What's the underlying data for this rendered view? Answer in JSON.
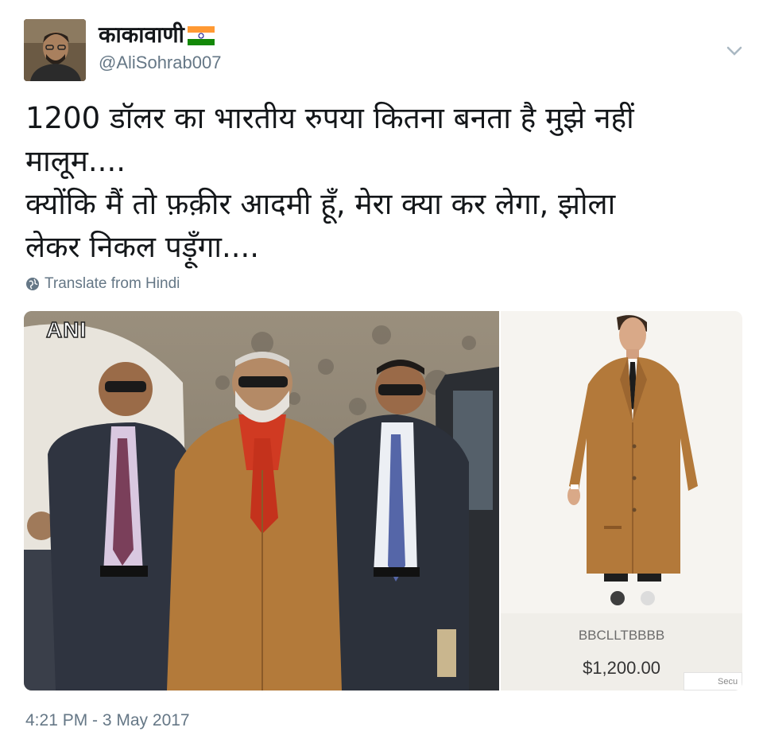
{
  "user": {
    "display_name": "काकावाणी",
    "handle": "@AliSohrab007",
    "avatar_icon": "profile-photo",
    "flag_icon": "india-flag-icon"
  },
  "tweet": {
    "lines": [
      "1200 डॉलर का भारतीय रुपया कितना बनता है मुझे नहीं",
      "मालूम....",
      "क्योंकि मैं तो फ़क़ीर आदमी हूँ, मेरा क्या कर लेगा, झोला",
      "लेकर निकल पड़ूँगा...."
    ],
    "translate_label": "Translate from Hindi",
    "timestamp": "4:21 PM - 3 May 2017"
  },
  "media": {
    "left_watermark": "ANI",
    "product": {
      "sku": "BBCLLTBBBB",
      "price": "$1,200.00",
      "secure_label": "Secu",
      "carousel_dots": 2,
      "active_dot": 1
    }
  },
  "colors": {
    "text_primary": "#14171a",
    "text_secondary": "#657786",
    "coat_camel": "#b37a3a"
  }
}
